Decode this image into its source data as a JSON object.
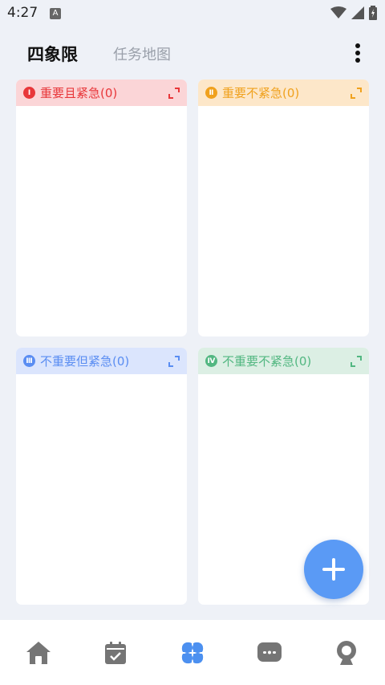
{
  "status": {
    "time": "4:27",
    "badge": "A"
  },
  "header": {
    "tab_active": "四象限",
    "tab_other": "任务地图"
  },
  "quadrants": [
    {
      "id": "q1",
      "numeral": "Ⅰ",
      "label": "重要且紧急(0)",
      "color": "#e8373a",
      "bg": "#fbd5d7"
    },
    {
      "id": "q2",
      "numeral": "Ⅱ",
      "label": "重要不紧急(0)",
      "color": "#f0a11d",
      "bg": "#fde7c9"
    },
    {
      "id": "q3",
      "numeral": "Ⅲ",
      "label": "不重要但紧急(0)",
      "color": "#5a8df2",
      "bg": "#dbe5fd"
    },
    {
      "id": "q4",
      "numeral": "Ⅳ",
      "label": "不重要不紧急(0)",
      "color": "#52b781",
      "bg": "#dcefe4"
    }
  ],
  "bottom_nav": [
    {
      "icon": "home-icon",
      "active": false
    },
    {
      "icon": "calendar-check-icon",
      "active": false
    },
    {
      "icon": "quadrants-icon",
      "active": true
    },
    {
      "icon": "chat-bubble-icon",
      "active": false
    },
    {
      "icon": "profile-icon",
      "active": false
    }
  ],
  "colors": {
    "accent": "#5a9af5",
    "inactive_icon": "#757575"
  }
}
